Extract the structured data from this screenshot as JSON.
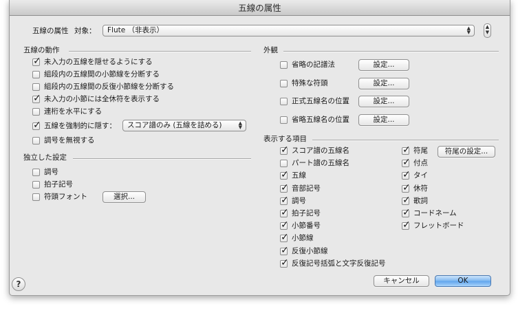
{
  "window": {
    "title": "五線の属性"
  },
  "header": {
    "staff_attr_label": "五線の属性",
    "target_label": "対象：",
    "target_value": "Flute （非表示）"
  },
  "behavior": {
    "title": "五線の動作",
    "items": [
      {
        "label": "未入力の五線を隠せるようにする",
        "checked": true
      },
      {
        "label": "組段内の五線間の小節線を分断する",
        "checked": false
      },
      {
        "label": "組段内の五線間の反復小節線を分断する",
        "checked": false
      },
      {
        "label": "未入力の小節には全休符を表示する",
        "checked": true
      },
      {
        "label": "連桁を水平にする",
        "checked": false
      },
      {
        "label": "五線を強制的に隠す：",
        "checked": true
      },
      {
        "label": "調号を無視する",
        "checked": false
      }
    ],
    "force_hide_value": "スコア譜のみ (五線を詰める)"
  },
  "independent": {
    "title": "独立した設定",
    "items": [
      {
        "label": "調号",
        "checked": false
      },
      {
        "label": "拍子記号",
        "checked": false
      },
      {
        "label": "符頭フォント",
        "checked": false
      }
    ],
    "select_button": "選択..."
  },
  "appearance": {
    "title": "外観",
    "items": [
      {
        "label": "省略の記譜法",
        "checked": false,
        "button": "設定..."
      },
      {
        "label": "特殊な符頭",
        "checked": false,
        "button": "設定..."
      },
      {
        "label": "正式五線名の位置",
        "checked": false,
        "button": "設定..."
      },
      {
        "label": "省略五線名の位置",
        "checked": false,
        "button": "設定..."
      }
    ]
  },
  "display": {
    "title": "表示する項目",
    "left_items": [
      {
        "label": "スコア譜の五線名",
        "checked": true
      },
      {
        "label": "パート譜の五線名",
        "checked": false
      },
      {
        "label": "五線",
        "checked": true
      },
      {
        "label": "音部記号",
        "checked": true
      },
      {
        "label": "調号",
        "checked": true
      },
      {
        "label": "拍子記号",
        "checked": true
      },
      {
        "label": "小節番号",
        "checked": true
      },
      {
        "label": "小節線",
        "checked": true
      },
      {
        "label": "反復小節線",
        "checked": true
      },
      {
        "label": "反復記号括弧と文字反復記号",
        "checked": true
      }
    ],
    "right_items": [
      {
        "label": "符尾",
        "checked": true
      },
      {
        "label": "付点",
        "checked": true
      },
      {
        "label": "タイ",
        "checked": true
      },
      {
        "label": "休符",
        "checked": true
      },
      {
        "label": "歌詞",
        "checked": true
      },
      {
        "label": "コードネーム",
        "checked": true
      },
      {
        "label": "フレットボード",
        "checked": true
      }
    ],
    "stem_settings_button": "符尾の設定..."
  },
  "footer": {
    "help": "?",
    "cancel": "キャンセル",
    "ok": "OK"
  }
}
